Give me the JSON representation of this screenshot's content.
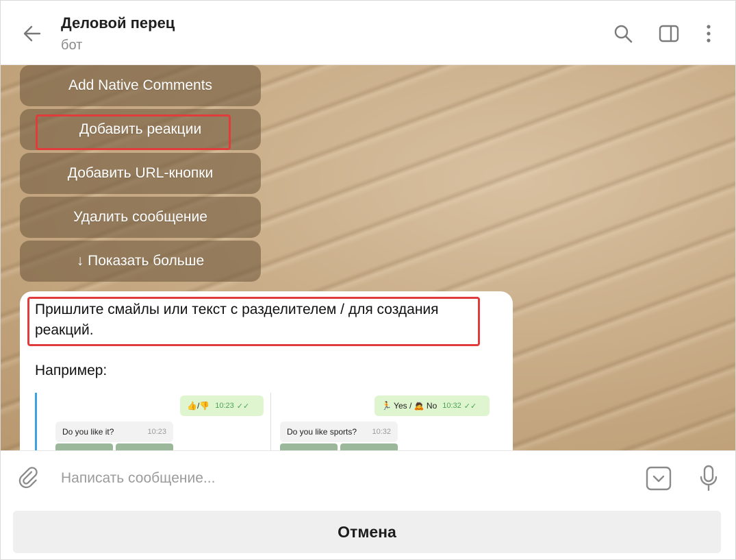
{
  "header": {
    "title": "Деловой перец",
    "subtitle": "бот"
  },
  "keyboard": {
    "buttons": [
      "Add Native Comments",
      "Добавить реакции",
      "Добавить URL-кнопки",
      "Удалить сообщение",
      "↓ Показать больше"
    ]
  },
  "message": {
    "text": "Пришлите смайлы или текст с разделителем / для создания реакций.",
    "example_label": "Например:"
  },
  "preview": {
    "left": {
      "out_text": "👍/👎",
      "out_time": "10:23",
      "in_text": "Do you like it?",
      "in_time": "10:23"
    },
    "right": {
      "out_text": "🏃 Yes / 🙇 No",
      "out_time": "10:32",
      "in_text": "Do you like sports?",
      "in_time": "10:32"
    }
  },
  "composer": {
    "placeholder": "Написать сообщение..."
  },
  "cancel": {
    "label": "Отмена"
  },
  "colors": {
    "highlight": "#e03c3c",
    "quote_bar": "#3aa3e3",
    "outgoing": "#dff5cf"
  }
}
